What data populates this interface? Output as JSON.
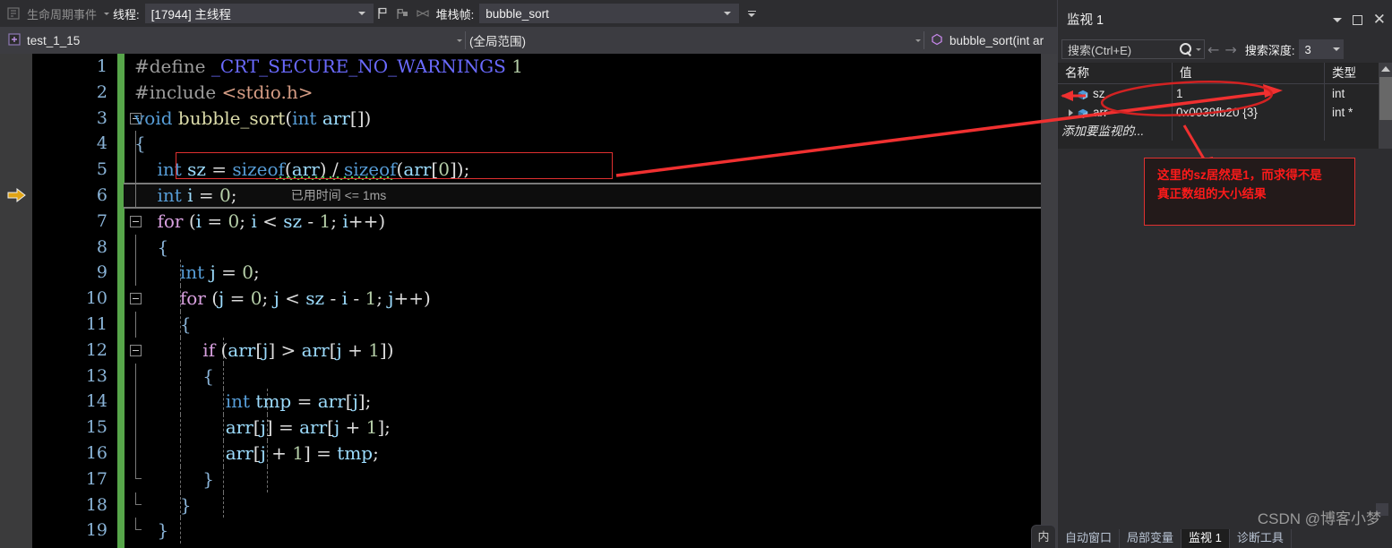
{
  "debug_toolbar": {
    "lifecycle_events_label": "生命周期事件",
    "thread_label": "线程:",
    "thread_value": "[17944] 主线程",
    "frame_label": "堆栈帧:",
    "frame_value": "bubble_sort",
    "icons": [
      "lifecycle-events-icon",
      "flag-icon",
      "flag-group-icon",
      "parallel-watch-icon",
      "toolbar-overflow-icon"
    ]
  },
  "nav_bar": {
    "project": "test_1_15",
    "scope": "(全局范围)",
    "function": "bubble_sort(int ar"
  },
  "editor": {
    "current_line": 6,
    "inline_diagnostic": "已用时间 <= 1ms",
    "lines": [
      {
        "n": 1,
        "text": "#define _CRT_SECURE_NO_WARNINGS 1"
      },
      {
        "n": 2,
        "text": "#include <stdio.h>"
      },
      {
        "n": 3,
        "text": "void bubble_sort(int arr[])"
      },
      {
        "n": 4,
        "text": "{"
      },
      {
        "n": 5,
        "text": "    int sz = sizeof(arr) / sizeof(arr[0]);"
      },
      {
        "n": 6,
        "text": "    int i = 0;"
      },
      {
        "n": 7,
        "text": "    for (i = 0; i < sz - 1; i++)"
      },
      {
        "n": 8,
        "text": "    {"
      },
      {
        "n": 9,
        "text": "        int j = 0;"
      },
      {
        "n": 10,
        "text": "        for (j = 0; j < sz - i - 1; j++)"
      },
      {
        "n": 11,
        "text": "        {"
      },
      {
        "n": 12,
        "text": "            if (arr[j] > arr[j + 1])"
      },
      {
        "n": 13,
        "text": "            {"
      },
      {
        "n": 14,
        "text": "                int tmp = arr[j];"
      },
      {
        "n": 15,
        "text": "                arr[j] = arr[j + 1];"
      },
      {
        "n": 16,
        "text": "                arr[j + 1] = tmp;"
      },
      {
        "n": 17,
        "text": "            }"
      },
      {
        "n": 18,
        "text": "        }"
      },
      {
        "n": 19,
        "text": "    }"
      }
    ]
  },
  "watch_panel": {
    "title": "监视 1",
    "title_buttons": [
      "window-menu-caret",
      "maximize-icon",
      "close-icon"
    ],
    "search_placeholder": "搜索(Ctrl+E)",
    "prev_label": "←",
    "next_label": "→",
    "depth_label": "搜索深度:",
    "depth_value": "3",
    "columns": [
      "名称",
      "值",
      "类型"
    ],
    "rows": [
      {
        "name": "sz",
        "value": "1",
        "type": "int",
        "expandable": false
      },
      {
        "name": "arr",
        "value": "0x0039fb20 {3}",
        "type": "int *",
        "expandable": true
      }
    ],
    "add_watch_placeholder": "添加要监视的...",
    "memory_tab": "内",
    "bottom_tabs": [
      {
        "label": "自动窗口",
        "active": false
      },
      {
        "label": "局部变量",
        "active": false
      },
      {
        "label": "监视 1",
        "active": true
      },
      {
        "label": "诊断工具",
        "active": false
      }
    ]
  },
  "annotations": {
    "note_line_1": "这里的sz居然是1，而求得不是",
    "note_line_2": "真正数组的大小结果",
    "color": "#ff1a1a",
    "shapes": [
      "red-ellipse-around-sz-row",
      "red-arrow-to-watch",
      "red-arrow-to-note",
      "red-rect-around-line5"
    ]
  },
  "watermark": "CSDN @博客小梦"
}
